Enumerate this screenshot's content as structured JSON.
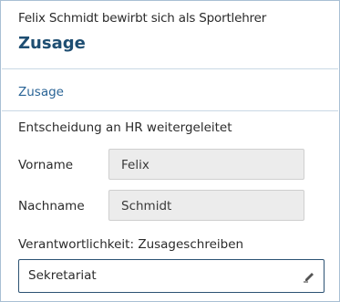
{
  "header": {
    "subtitle": "Felix Schmidt bewirbt sich als Sportlehrer",
    "title": "Zusage"
  },
  "section": {
    "tab_label": "Zusage"
  },
  "form": {
    "status_text": "Entscheidung an HR weitergeleitet",
    "fields": [
      {
        "label": "Vorname",
        "value": "Felix"
      },
      {
        "label": "Nachname",
        "value": "Schmidt"
      }
    ],
    "responsibility": {
      "label": "Verantwortlichkeit: Zusageschreiben",
      "value": "Sekretariat",
      "icon": "pencil-icon"
    }
  },
  "colors": {
    "title": "#1e4e72",
    "link": "#2a6496",
    "frame_border": "#a9bfd4",
    "input_border": "#2c5273",
    "readonly_bg": "#ececec"
  }
}
